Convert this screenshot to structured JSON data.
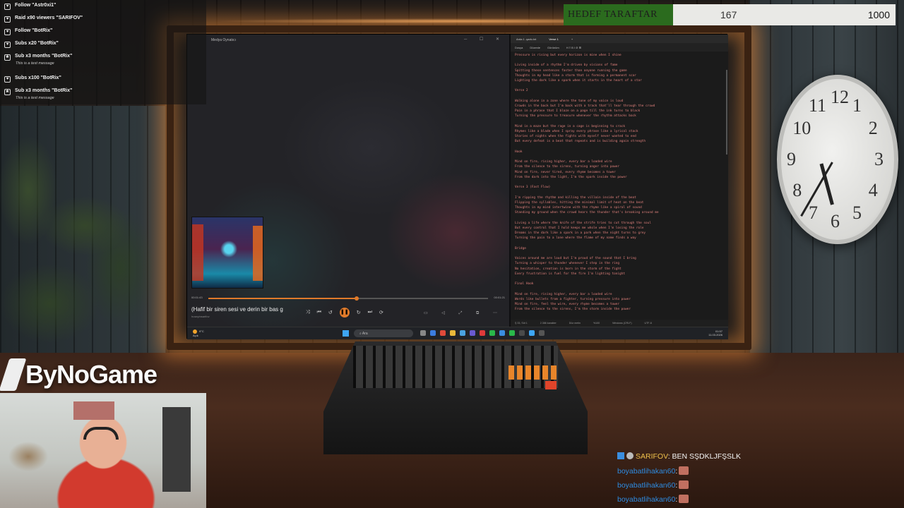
{
  "alerts": [
    {
      "icon": "heart-icon",
      "text": "Follow \"Astr0xi1\""
    },
    {
      "icon": "heart-icon",
      "text": "Raid x90 viewers \"SARIFOV\""
    },
    {
      "icon": "heart-icon",
      "text": "Follow \"BotRix\""
    },
    {
      "icon": "heart-icon",
      "text": "Subs x20 \"BotRix\""
    },
    {
      "icon": "star-icon",
      "text": "Sub x3 months \"BotRix\"",
      "sub": "This is a test message"
    },
    {
      "icon": "heart-icon",
      "text": "Subs x100 \"BotRix\""
    },
    {
      "icon": "star-icon",
      "text": "Sub x3 months \"BotRix\"",
      "sub": "This is a test message"
    }
  ],
  "goal": {
    "label": "HEDEF TARAFTAR",
    "current": "167",
    "max": "1000",
    "progress": 0.167
  },
  "brand": {
    "name": "ByNoGame"
  },
  "media_player": {
    "title": "Medya Oynatıcı",
    "song_title": "(Hafif bir siren sesi ve derin bir bas g",
    "artist": "huseyinsarifov",
    "time_elapsed": "00:01:43",
    "time_total": "00:01:21",
    "progress": 0.53
  },
  "editor": {
    "tabs": [
      "Arda 1 -şarkı.txt",
      "Verse 1"
    ],
    "menu": [
      "Dosya",
      "Düzenle",
      "Görünüm"
    ],
    "lines": [
      "Pressure is rising but every horizon is mine when I shine",
      "",
      "Living inside of a rhythm I'm driven by visions of fame",
      "Spitting these sentences faster than anyone running the game",
      "Thoughts in my head like a storm that is forming a permanent scar",
      "Lighting the dark like a spark when it starts in the heart of a star",
      "",
      "Verse 2",
      "",
      "Walking alone in a zone where the tone of my voice is loud",
      "Crowds in the back but I'm back with a track that'll tear through the crowd",
      "Pain in a phrase that I blaze on a page till the ink turns to black",
      "Turning the pressure to treasure whenever the rhythm attacks back",
      "",
      "Mind in a maze but the rage in a cage is beginning to crack",
      "Rhymes like a blade when I spray every phrase like a lyrical stack",
      "Stories of nights when the fights with myself never wanted to end",
      "But every defeat is a beat that repeats and is building again strength",
      "",
      "Hook",
      "",
      "Mind on fire, rising higher, every bar a loaded wire",
      "From the silence to the sirens, turning anger into power",
      "Mind on fire, never tired, every rhyme becomes a tower",
      "From the dark into the light, I'm the spark inside the power",
      "",
      "Verse 3 (Fast Flow)",
      "",
      "I'm ripping the rhythm and killing the villain inside of the beat",
      "Flipping the syllables, hitting the minimal limit of heat on the beat",
      "Thoughts in my mind intertwine with the rhyme like a spiral of sound",
      "Standing my ground when the crowd hears the thunder that's breaking around me",
      "",
      "Living a life where the knife of the strife tries to cut through the soul",
      "But every control that I hold keeps me whole when I'm losing the role",
      "Dreams in the dark like a spark in a park when the night turns to grey",
      "Turning the pain to a lane where the flame of my name finds a way",
      "",
      "Bridge",
      "",
      "Voices around me are loud but I'm proud of the sound that I bring",
      "Turning a whisper to thunder whenever I step in the ring",
      "No hesitation, creation is born in the storm of the fight",
      "Every frustration is fuel for the fire I'm lighting tonight",
      "",
      "Final Hook",
      "",
      "Mind on fire, rising higher, every bar a loaded wire",
      "Words like bullets from a fighter, turning pressure into power",
      "Mind on fire, feel the wire, every rhyme becomes a tower",
      "From the silence to the sirens, I'm the storm inside the power"
    ],
    "status": {
      "position": "Ş 33, Süt 1",
      "chars": "2.386 karakter",
      "mode": "Düz metin",
      "zoom": "%100",
      "eol": "Windows (CRLF)",
      "encoding": "UTF-8"
    }
  },
  "taskbar": {
    "weather_temp": "9°C",
    "weather_desc": "Açık",
    "search_placeholder": "Ara",
    "time": "01:57",
    "date": "11.03.2026"
  },
  "clock": {
    "numbers": [
      "12",
      "1",
      "2",
      "3",
      "4",
      "5",
      "6",
      "7",
      "8",
      "9",
      "10",
      "11"
    ]
  },
  "chat": [
    {
      "user": "SARIFOV",
      "message": ": BEN SŞDKLJFŞSLK",
      "first": true
    },
    {
      "user": "boyabatlihakan60",
      "message": ":",
      "emote": true
    },
    {
      "user": "boyabatlihakan60",
      "message": ":",
      "emote": true
    },
    {
      "user": "boyabatlihakan60",
      "message": ":",
      "emote": true
    }
  ],
  "colors": {
    "accent": "#e07a2a",
    "goal_fill": "#2b6b1e",
    "chat_name": "#2e8be0"
  }
}
